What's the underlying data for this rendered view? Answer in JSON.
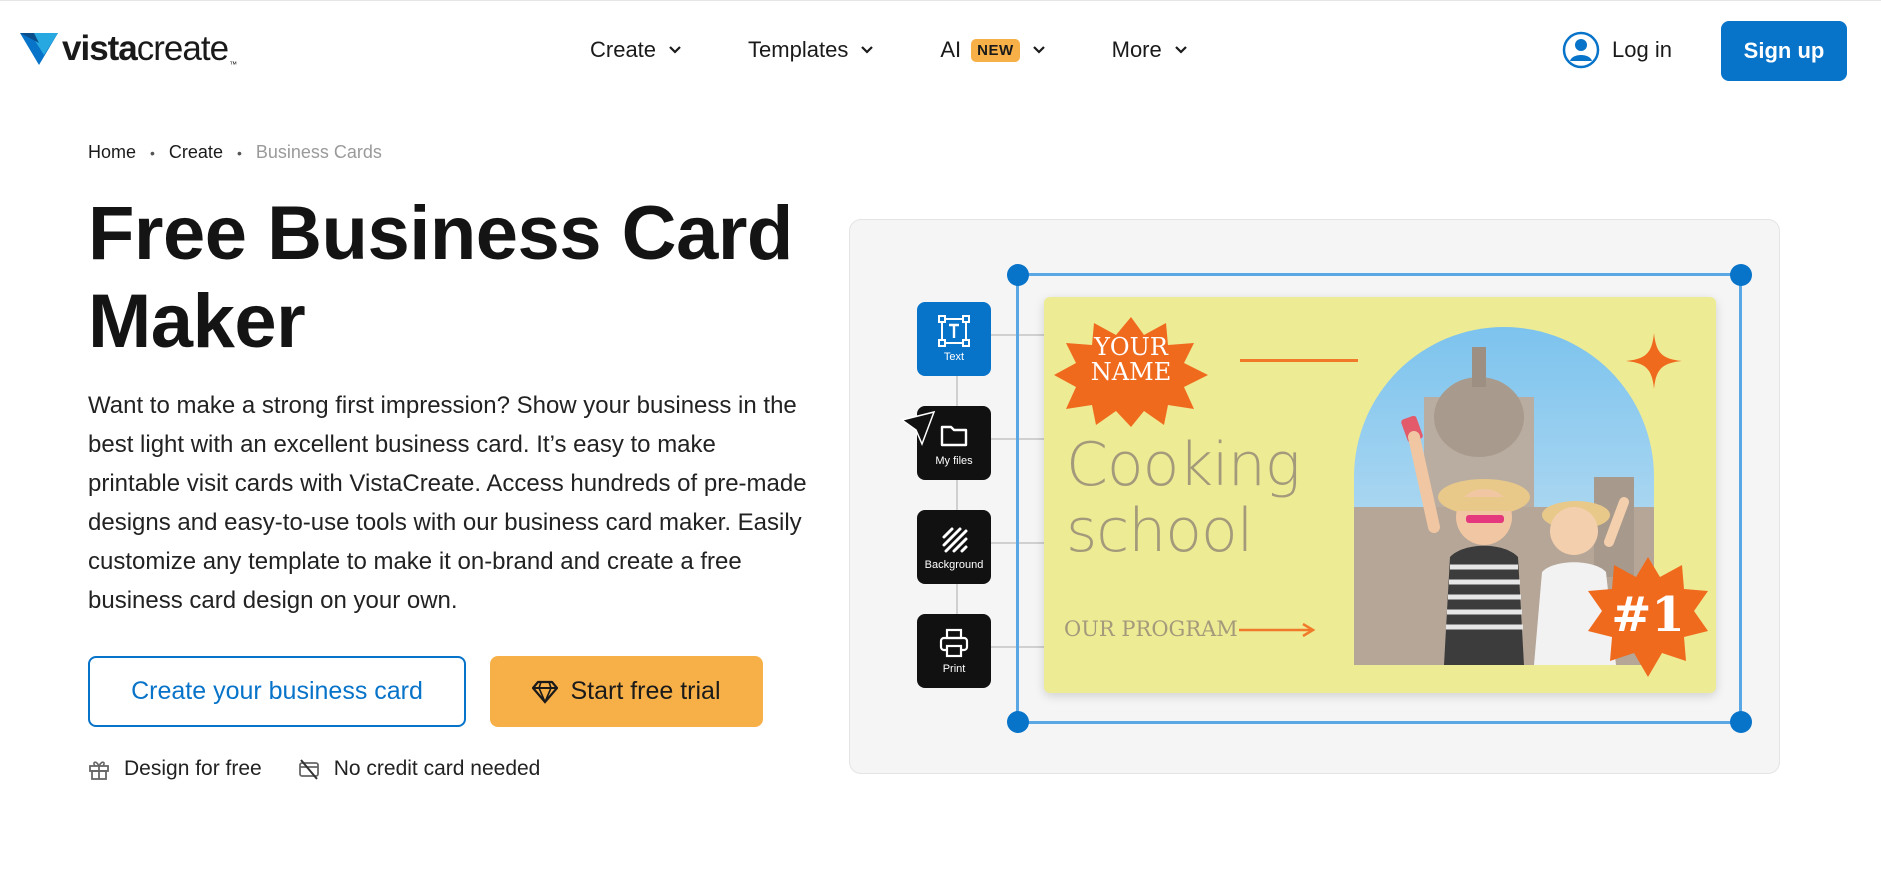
{
  "header": {
    "logo_bold": "vista",
    "logo_regular": "create",
    "logo_tm": "™",
    "nav": [
      {
        "label": "Create"
      },
      {
        "label": "Templates"
      },
      {
        "label": "AI",
        "badge": "NEW"
      },
      {
        "label": "More"
      }
    ],
    "login_label": "Log in",
    "signup_label": "Sign up"
  },
  "breadcrumb": {
    "items": [
      "Home",
      "Create"
    ],
    "current": "Business Cards"
  },
  "hero": {
    "title": "Free Business Card Maker",
    "description": "Want to make a strong first impression? Show your business in the best light with an excellent business card. It’s easy to make printable visit cards with VistaCreate. Access hundreds of pre-made designs and easy-to-use tools with our business card maker. Easily customize any template to make it on-brand and create a free business card design on your own.",
    "cta_primary": "Create your business card",
    "cta_secondary": "Start free trial",
    "perks": [
      "Design for free",
      "No credit card needed"
    ]
  },
  "illustration": {
    "tools": [
      {
        "label": "Text",
        "icon": "text-tool-icon",
        "active": true
      },
      {
        "label": "My files",
        "icon": "folder-icon",
        "active": false
      },
      {
        "label": "Background",
        "icon": "background-icon",
        "active": false
      },
      {
        "label": "Print",
        "icon": "printer-icon",
        "active": false
      }
    ],
    "card": {
      "your_name_line1": "YOUR",
      "your_name_line2": "NAME",
      "headline_line1": "Cooking",
      "headline_line2": "school",
      "program": "OUR PROGRAM",
      "badge": "#1"
    }
  },
  "colors": {
    "brand_blue": "#0773c9",
    "accent_orange": "#f7b048",
    "card_yellow": "#eeeb95",
    "burst_orange": "#f06a1e"
  }
}
